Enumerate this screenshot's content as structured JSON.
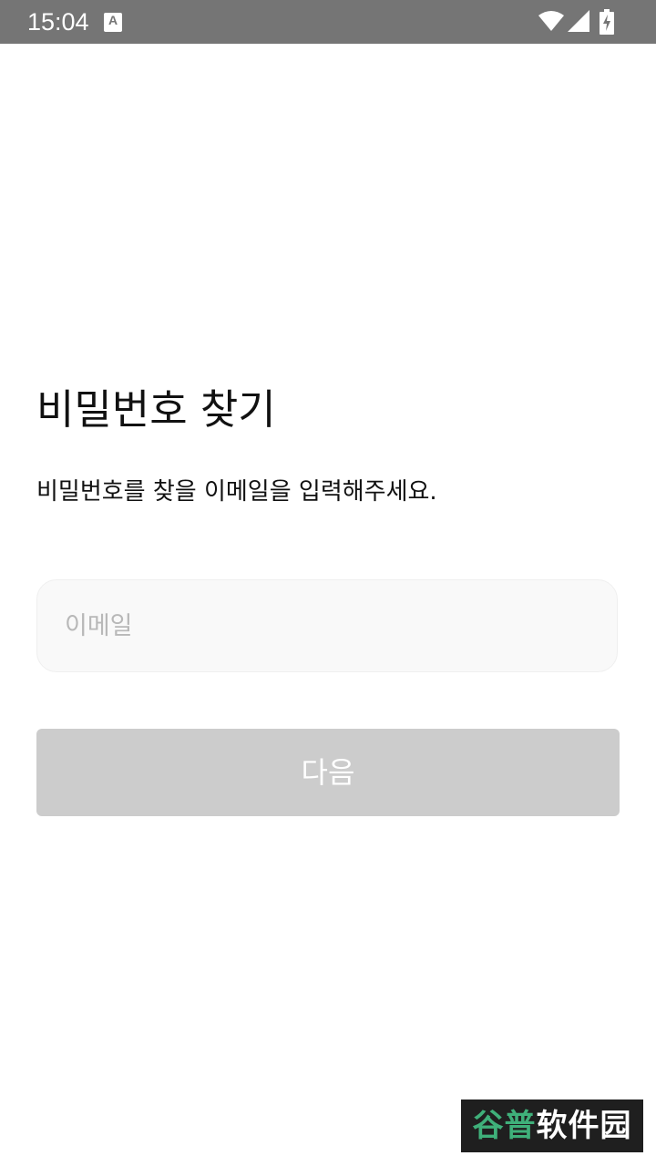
{
  "status_bar": {
    "time": "15:04",
    "app_icon_letter": "A",
    "icons": [
      "wifi-icon",
      "signal-icon",
      "battery-charging-icon"
    ]
  },
  "page": {
    "title": "비밀번호 찾기",
    "description": "비밀번호를 찾을 이메일을 입력해주세요."
  },
  "form": {
    "email_value": "",
    "email_placeholder": "이메일",
    "next_label": "다음"
  },
  "watermark": {
    "accent_text": "谷普",
    "text": "软件园"
  },
  "colors": {
    "status_bar": "#757575",
    "button_disabled": "#cccccc",
    "input_background": "#f9f9f9"
  }
}
